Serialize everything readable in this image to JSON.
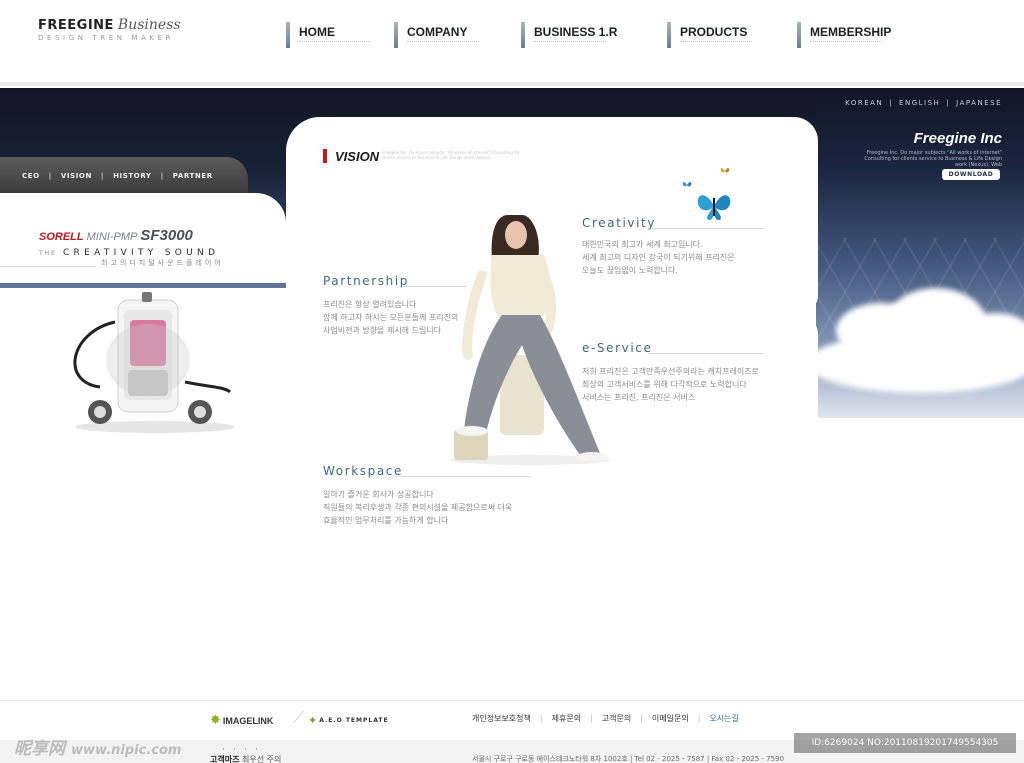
{
  "header": {
    "logo_main": "FREEGINE",
    "logo_script": "Business",
    "logo_sub": "DESIGN TREN MAKER"
  },
  "nav": [
    {
      "label": "HOME"
    },
    {
      "label": "COMPANY"
    },
    {
      "label": "BUSINESS 1.R"
    },
    {
      "label": "PRODUCTS"
    },
    {
      "label": "MEMBERSHIP"
    }
  ],
  "languages": [
    "KOREAN",
    "ENGLISH",
    "JAPANESE"
  ],
  "company": {
    "name": "Freegine Inc",
    "description": "Freegine Inc. Do major subjects \"All works of internet\" Consulting for clients service to Business & Life Design work (Nexus), Web",
    "download_label": "DOWNLOAD"
  },
  "subnav": [
    "CEO",
    "VISION",
    "HISTORY",
    "PARTNER"
  ],
  "product": {
    "brand": "SORELL",
    "model": "MINI-PMP",
    "code": "SF3000",
    "the": "THE",
    "slogan": "CREATIVITY SOUND",
    "korean": "최고의디지털사운드플레이어"
  },
  "vision": {
    "title": "VISION",
    "description": "Freegine Inc. Do major subjects \"All works of internet\" Consulting for clients service to Business & Life Design work (Nexus)"
  },
  "sections": {
    "partnership": {
      "title": "Partnership",
      "lines": [
        "프리진은 항상 열려있습니다",
        "함께 하고자 하시는 모든분들께 프리진의",
        "사업비젼과 방향을 제시해 드립니다"
      ]
    },
    "creativity": {
      "title": "Creativity",
      "lines": [
        "대한민국의 최고가 세계 최고입니다.",
        "세계 최고의 디자인 강국이 되기위해 프리진은",
        "오늘도 끊임없이 노력합니다."
      ]
    },
    "eservice": {
      "title": "e-Service",
      "lines": [
        "저희 프리진은 고객만족우선주의라는 캐치프레이즈로",
        "최상의 고객서비스를 위해 다각적으로 노력합니다",
        "서비스는 프리진, 프리진은 서비스"
      ]
    },
    "workspace": {
      "title": "Workspace",
      "lines": [
        "일하기 즐거운 회사가 성공합니다",
        "직원들의 복리후생과 각종 편의시설을 제공함으로써 더욱",
        "효율적인 업무처리를 가능하게 합니다"
      ]
    }
  },
  "footer": {
    "logo1": "IMAGELINK",
    "logo2": "A.E.O TEMPLATE",
    "links": [
      "개인정보보호정책",
      "제휴문의",
      "고객문의",
      "이메일문의",
      "오시는길"
    ],
    "dots": "· · · ·",
    "info_label": "고객마즈",
    "info_text": "최우선 주의",
    "address": "서울시 구로구 구로동 에이스테크노타워 8차 1002호  |  Tel 02 - 2025 - 7587  |  Fax 02 - 2025 - 7590"
  },
  "watermarks": {
    "left_brand": "昵享网",
    "left_url": "www.nipic.com",
    "right_id": "ID:6269024 NO:20110819201749554305"
  },
  "colors": {
    "accent_red": "#c4161c",
    "heading_blue": "#3c6a84",
    "dark_navy": "#101625"
  }
}
